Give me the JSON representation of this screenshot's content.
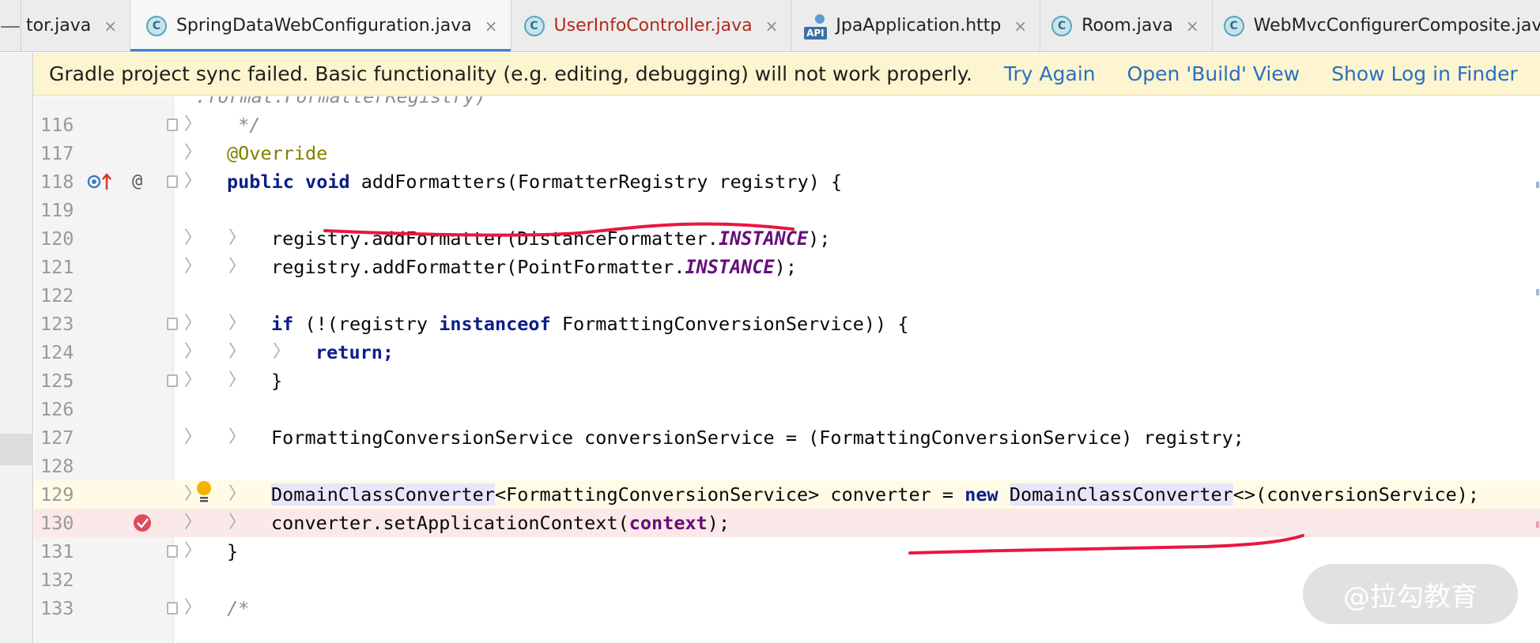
{
  "tabs": [
    {
      "label": "tor.java",
      "icon": "none",
      "active": false,
      "color": "#222222"
    },
    {
      "label": "SpringDataWebConfiguration.java",
      "icon": "class-icon",
      "active": true,
      "color": "#222222"
    },
    {
      "label": "UserInfoController.java",
      "icon": "class-icon",
      "active": false,
      "color": "#b2291f"
    },
    {
      "label": "JpaApplication.http",
      "icon": "api-icon",
      "active": false,
      "color": "#222222"
    },
    {
      "label": "Room.java",
      "icon": "class-icon",
      "active": false,
      "color": "#222222"
    },
    {
      "label": "WebMvcConfigurerComposite.java",
      "icon": "class-icon",
      "active": false,
      "color": "#222222"
    }
  ],
  "tab_close_glyph": "×",
  "class_icon_letter": "C",
  "api_icon_label": "API",
  "notification": {
    "message": "Gradle project sync failed. Basic functionality (e.g. editing, debugging) will not work properly.",
    "links": [
      "Try Again",
      "Open 'Build' View",
      "Show Log in Finder"
    ]
  },
  "editor": {
    "lines": [
      {
        "num": "",
        "text": ".format.FormatterRegistry)"
      },
      {
        "num": "116",
        "text": " */"
      },
      {
        "num": "117",
        "text": "@Override"
      },
      {
        "num": "118",
        "text": "public void addFormatters(FormatterRegistry registry) {"
      },
      {
        "num": "119",
        "text": ""
      },
      {
        "num": "120",
        "text": "registry.addFormatter(DistanceFormatter.INSTANCE);"
      },
      {
        "num": "121",
        "text": "registry.addFormatter(PointFormatter.INSTANCE);"
      },
      {
        "num": "122",
        "text": ""
      },
      {
        "num": "123",
        "text": "if (!(registry instanceof FormattingConversionService)) {"
      },
      {
        "num": "124",
        "text": "return;"
      },
      {
        "num": "125",
        "text": "}"
      },
      {
        "num": "126",
        "text": ""
      },
      {
        "num": "127",
        "text": "FormattingConversionService conversionService = (FormattingConversionService) registry;"
      },
      {
        "num": "128",
        "text": ""
      },
      {
        "num": "129",
        "text": "DomainClassConverter<FormattingConversionService> converter = new DomainClassConverter<>(conversionService);"
      },
      {
        "num": "130",
        "text": "converter.setApplicationContext(context);"
      },
      {
        "num": "131",
        "text": "}"
      },
      {
        "num": "132",
        "text": ""
      },
      {
        "num": "133",
        "text": "/*"
      }
    ]
  },
  "gutter": {
    "line118_annotation_glyph": "@",
    "line118_override_glyph": "↑"
  },
  "watermark": "@拉勾教育",
  "colors": {
    "keyword": "#0c1e8a",
    "annotation": "#808000",
    "static_field": "#660e7a",
    "link": "#2a6fc4",
    "notification_bg": "#fdf5cf",
    "underline_red": "#e8173f",
    "breakpoint": "#db4b5a"
  }
}
